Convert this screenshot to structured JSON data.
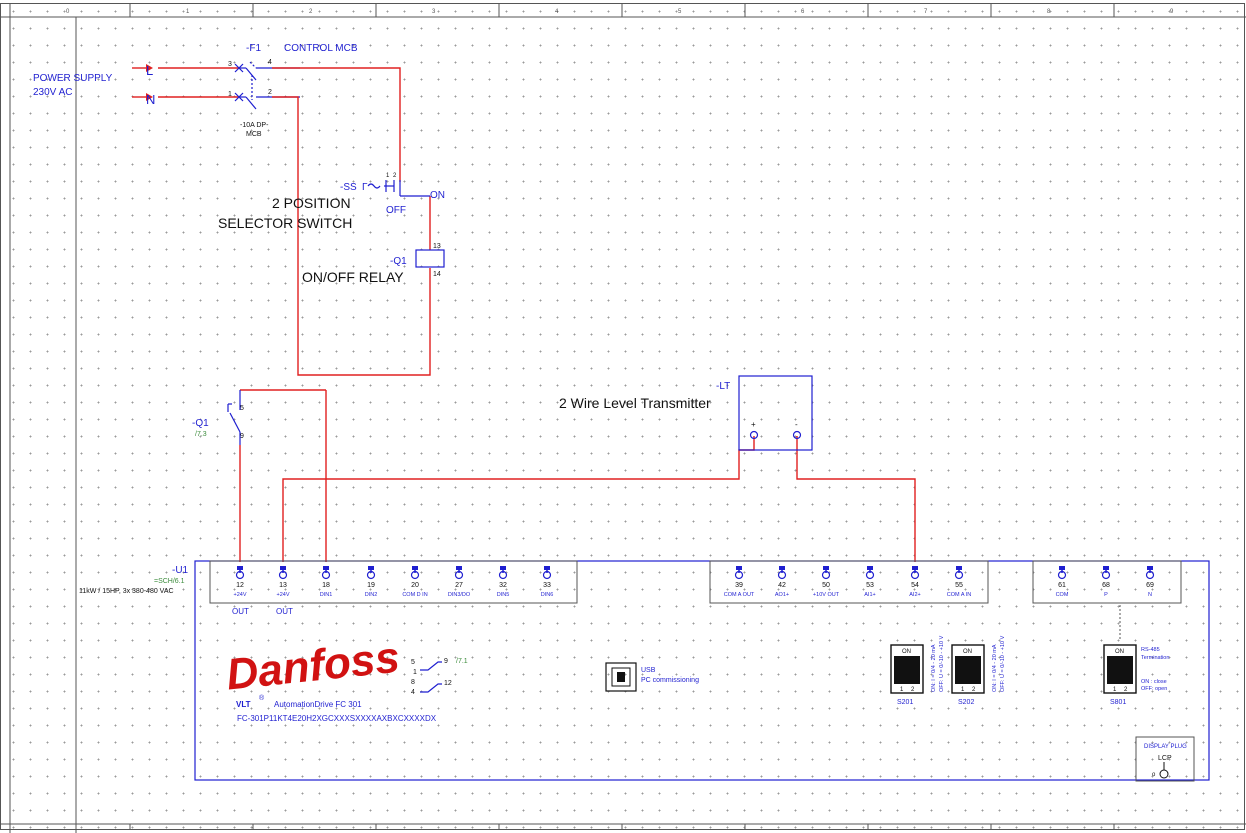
{
  "supply": {
    "label_line1": "POWER SUPPLY",
    "label_line2": "230V AC",
    "L": "L",
    "N": "N"
  },
  "mcb": {
    "tag": "-F1",
    "title": "CONTROL MCB",
    "spec_line1": "-10A DP-",
    "spec_line2": "MCB",
    "t3": "3",
    "t4": "4",
    "t1": "1",
    "t2": "2"
  },
  "selector": {
    "tag": "-SS",
    "title_line1": "2 POSITION",
    "title_line2": "SELECTOR SWITCH",
    "off": "OFF",
    "on": "ON",
    "pin1": "1",
    "pin2": "2"
  },
  "relay": {
    "tag": "-Q1",
    "title": "ON/OFF RELAY",
    "pin13": "13",
    "pin14": "14"
  },
  "contact": {
    "tag": "-Q1",
    "ref": "/7.3",
    "pin5": "5",
    "pin9": "9"
  },
  "transmitter": {
    "tag": "-LT",
    "title": "2 Wire Level Transmitter",
    "plus": "+",
    "minus": "-"
  },
  "drive": {
    "tag": "-U1",
    "ref": "=SCH/6.1",
    "rating": "11kW / 15HP, 3x 380-480 VAC",
    "logo": "Danfoss",
    "vlt": "VLT",
    "reg": "®",
    "product": "AutomationDrive FC 301",
    "code": "FC-301P11KT4E20H2XGCXXXSXXXXAXBXCXXXXDX",
    "usb_line1": "USB",
    "usb_line2": "PC commissioning",
    "out1": "OUT",
    "out2": "OUT",
    "relay_ref": "/7.1",
    "relay_pins": [
      "5",
      "9",
      "1",
      "8",
      "12",
      "4"
    ],
    "terms_digital": [
      {
        "num": "12",
        "label": "+24V"
      },
      {
        "num": "13",
        "label": "+24V"
      },
      {
        "num": "18",
        "label": "DIN1"
      },
      {
        "num": "19",
        "label": "DIN2"
      },
      {
        "num": "20",
        "label": "COM D IN"
      },
      {
        "num": "27",
        "label": "DIN3/DO"
      },
      {
        "num": "32",
        "label": "DIN5"
      },
      {
        "num": "33",
        "label": "DIN6"
      }
    ],
    "terms_analog": [
      {
        "num": "39",
        "label": "COM A OUT"
      },
      {
        "num": "42",
        "label": "AO1+"
      },
      {
        "num": "50",
        "label": "+10V OUT"
      },
      {
        "num": "53",
        "label": "AI1+"
      },
      {
        "num": "54",
        "label": "AI2+"
      },
      {
        "num": "55",
        "label": "COM A IN"
      }
    ],
    "terms_rs485": [
      {
        "num": "61",
        "label": "COM"
      },
      {
        "num": "68",
        "label": "P"
      },
      {
        "num": "69",
        "label": "N"
      }
    ],
    "switches": [
      {
        "name": "S201",
        "on": "ON",
        "p1": "1",
        "p2": "2",
        "note1": "ON: I = 0/4 - 20 mA",
        "note2": "OFF: U = 0/-10 - +10 V"
      },
      {
        "name": "S202",
        "on": "ON",
        "p1": "1",
        "p2": "2",
        "note1": "ON: I = 0/4 - 20 mA",
        "note2": "OFF: U = 0/-10 - +10 V"
      },
      {
        "name": "S801",
        "on": "ON",
        "p1": "1",
        "p2": "2",
        "note1": "RS-485",
        "note2": "Termination",
        "note3": "ON : close",
        "note4": "OFF: open"
      }
    ],
    "display_plug": "DISPLAY PLUG",
    "lcp": "LCP"
  },
  "border_numbers": [
    "0",
    "1",
    "2",
    "3",
    "4",
    "5",
    "6",
    "7",
    "8",
    "9"
  ],
  "colors": {
    "wire": "#e02020",
    "symbol": "#1f1fd0",
    "logo": "#d11212",
    "ref": "#3c8c3c"
  }
}
